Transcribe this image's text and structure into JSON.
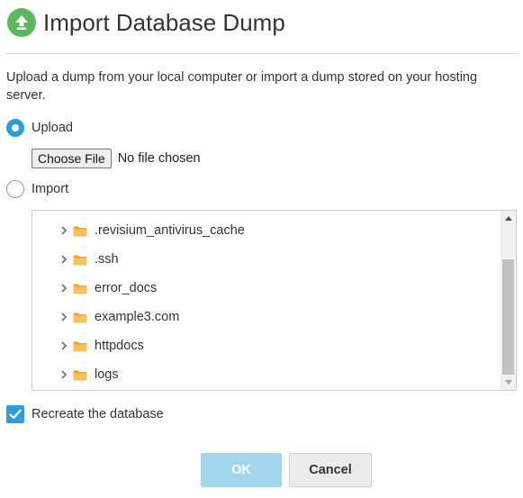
{
  "dialog": {
    "title": "Import Database Dump",
    "intro": "Upload a dump from your local computer or import a dump stored on your hosting server."
  },
  "source": {
    "upload_label": "Upload",
    "import_label": "Import",
    "selected": "Upload"
  },
  "file_input": {
    "button_label": "Choose File",
    "status": "No file chosen"
  },
  "tree": {
    "items": [
      {
        "label": ".revisium_antivirus_cache",
        "expandable": true,
        "icon": "folder-icon"
      },
      {
        "label": ".ssh",
        "expandable": true,
        "icon": "folder-icon"
      },
      {
        "label": "error_docs",
        "expandable": true,
        "icon": "folder-icon"
      },
      {
        "label": "example3.com",
        "expandable": true,
        "icon": "folder-icon"
      },
      {
        "label": "httpdocs",
        "expandable": true,
        "icon": "folder-icon"
      },
      {
        "label": "logs",
        "expandable": true,
        "icon": "folder-icon"
      }
    ]
  },
  "options": {
    "recreate_label": "Recreate the database",
    "recreate_checked": true
  },
  "buttons": {
    "ok_label": "OK",
    "cancel_label": "Cancel"
  },
  "colors": {
    "accent": "#2b9fd9",
    "header_icon": "#5cb85c",
    "folder": "#f5a623",
    "ok_disabled": "#a4d7ee"
  }
}
